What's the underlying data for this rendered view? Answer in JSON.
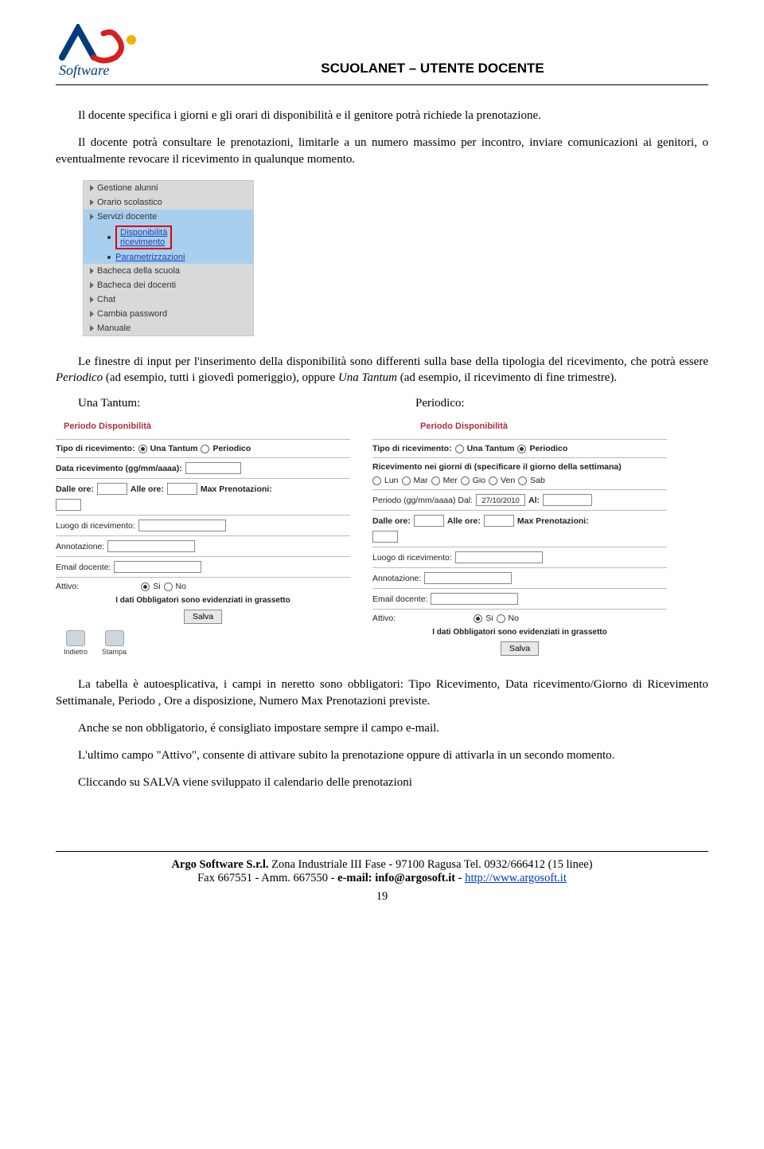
{
  "header": {
    "title": "SCUOLANET – UTENTE DOCENTE"
  },
  "para1": "Il docente specifica i giorni e gli orari di disponibilità e il genitore potrà richiede la prenotazione.",
  "para2": "Il docente potrà consultare le prenotazioni, limitarle a un numero massimo per incontro, inviare comunicazioni ai genitori, o eventualmente revocare il ricevimento in qualunque momento.",
  "nav": {
    "items": [
      "Gestione alunni",
      "Orario scolastico",
      "Servizi docente",
      "Bacheca della scuola",
      "Bacheca dei docenti",
      "Chat",
      "Cambia password",
      "Manuale"
    ],
    "sub1a": "Disponibilità",
    "sub1b": "ricevimento",
    "sub2": "Parametrizzazioni"
  },
  "para3a": "Le finestre di input per l'inserimento della disponibilità sono differenti sulla base della tipologia del ricevimento, che potrà essere ",
  "para3_em1": "Periodico",
  "para3b": " (ad esempio, tutti i giovedì pomeriggio), oppure ",
  "para3_em2": "Una Tantum",
  "para3c": " (ad esempio, il ricevimento di fine trimestre).",
  "col_left_label": "Una Tantum:",
  "col_right_label": "Periodico:",
  "form": {
    "title": "Periodo Disponibilità",
    "tipo": "Tipo di ricevimento:",
    "una": "Una Tantum",
    "per": "Periodico",
    "data_left": "Data ricevimento (gg/mm/aaaa):",
    "ric_giorni": "Ricevimento nei giorni di (specificare il giorno della settimana)",
    "days": [
      "Lun",
      "Mar",
      "Mer",
      "Gio",
      "Ven",
      "Sab"
    ],
    "periodo": "Periodo (gg/mm/aaaa) Dal:",
    "periodo_date": "27/10/2010",
    "al": "Al:",
    "dalle": "Dalle ore:",
    "alle": "Alle ore:",
    "max": "Max Prenotazioni:",
    "luogo": "Luogo di ricevimento:",
    "annot": "Annotazione:",
    "email": "Email docente:",
    "attivo": "Attivo:",
    "si": "Si",
    "no": "No",
    "obbl": "I dati Obbligatori sono evidenziati in grassetto",
    "salva": "Salva",
    "indietro": "Indietro",
    "stampa": "Stampa"
  },
  "para4": "La tabella è autoesplicativa, i campi in neretto sono obbligatori:  Tipo Ricevimento, Data ricevimento/Giorno di Ricevimento Settimanale, Periodo , Ore a disposizione, Numero Max Prenotazioni previste.",
  "para5": "Anche se non obbligatorio, é consigliato impostare sempre il campo e-mail.",
  "para6": "L'ultimo campo \"Attivo\", consente di attivare subito la prenotazione oppure di attivarla in un secondo momento.",
  "para7": "Cliccando su SALVA viene sviluppato il calendario delle prenotazioni",
  "footer": {
    "l1a": "Argo Software S.r.l.",
    "l1b": " Zona Industriale III Fase - 97100 Ragusa Tel. 0932/666412 (15 linee)",
    "l2a": "Fax 667551 - Amm. 667550 - ",
    "l2b": "e-mail: info@argosoft.it - ",
    "l2c": "http://www.argosoft.it"
  },
  "page": "19"
}
